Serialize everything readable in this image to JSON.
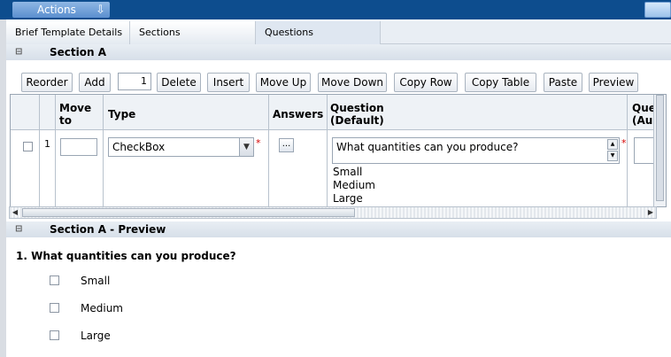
{
  "header": {
    "actions_label": "Actions"
  },
  "tabs": [
    {
      "label": "Brief Template Details"
    },
    {
      "label": "Sections"
    },
    {
      "label": "Questions"
    }
  ],
  "section": {
    "title": "Section A"
  },
  "toolbar": {
    "reorder": "Reorder",
    "add": "Add",
    "add_count": "1",
    "delete": "Delete",
    "insert": "Insert",
    "move_up": "Move Up",
    "move_down": "Move Down",
    "copy_row": "Copy Row",
    "copy_table": "Copy Table",
    "paste": "Paste",
    "preview": "Preview"
  },
  "grid": {
    "headers": {
      "move_to_line1": "Move",
      "move_to_line2": "to",
      "type": "Type",
      "answers": "Answers",
      "question_line1": "Question",
      "question_line2": "(Default)",
      "question_aus_line1": "Ques",
      "question_aus_line2": "(Aus"
    },
    "rows": [
      {
        "row_number": "1",
        "type_value": "CheckBox",
        "answers_button": "...",
        "question_text": "What quantities can you produce?",
        "options": [
          "Small",
          "Medium",
          "Large"
        ]
      }
    ]
  },
  "preview": {
    "title": "Section A - Preview",
    "question": "1. What quantities can you produce?",
    "options": [
      "Small",
      "Medium",
      "Large"
    ]
  },
  "colors": {
    "header_bar": "#0d4d8e",
    "required": "#d40000"
  }
}
